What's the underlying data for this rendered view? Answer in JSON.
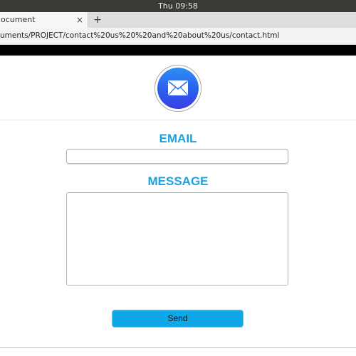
{
  "system_bar": {
    "clock": "Thu 09:58"
  },
  "browser": {
    "tab": {
      "title": "ocument",
      "close_symbol": "×"
    },
    "new_tab_symbol": "+",
    "url": "uments/PROJECT/contact%20us%20%20and%20about%20us/contact.html"
  },
  "page": {
    "logo_icon": "mail-envelope-icon",
    "colors": {
      "accent": "#1aa3e0",
      "button": "#0ea8e8",
      "logo_top": "#2f8ff3",
      "logo_bottom": "#3b3de3"
    },
    "form": {
      "email_label": "EMAIL",
      "email_value": "",
      "message_label": "MESSAGE",
      "message_value": "",
      "send_label": "Send"
    }
  }
}
